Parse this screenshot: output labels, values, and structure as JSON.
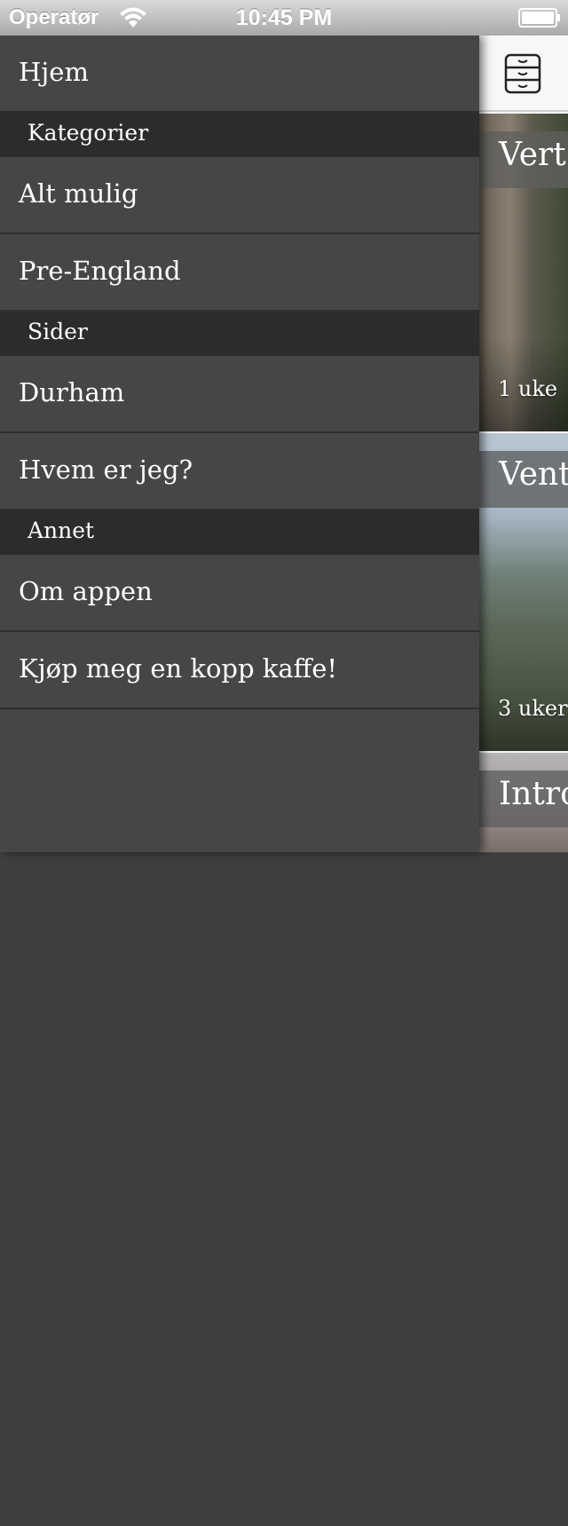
{
  "status_bar": {
    "carrier": "Operatør",
    "time": "10:45 PM",
    "wifi_icon": "wifi-icon",
    "battery_icon": "battery-icon"
  },
  "menu": {
    "home": "Hjem",
    "sections": [
      {
        "header": "Kategorier",
        "items": [
          "Alt mulig",
          "Pre-England"
        ]
      },
      {
        "header": "Sider",
        "items": [
          "Durham",
          "Hvem er jeg?"
        ]
      },
      {
        "header": "Annet",
        "items": [
          "Om appen",
          "Kjøp meg en kopp kaffe!"
        ]
      }
    ]
  },
  "content": {
    "archive_icon": "archive-icon",
    "posts": [
      {
        "title": "Vert",
        "age": "1 uke"
      },
      {
        "title": "Vent",
        "age": "3 uker"
      },
      {
        "title": "Intro"
      }
    ]
  },
  "colors": {
    "menu_background": "#464646",
    "section_header_background": "#2c2c2c",
    "menu_text": "#ffffff",
    "status_bar": "#bdbdbd"
  }
}
